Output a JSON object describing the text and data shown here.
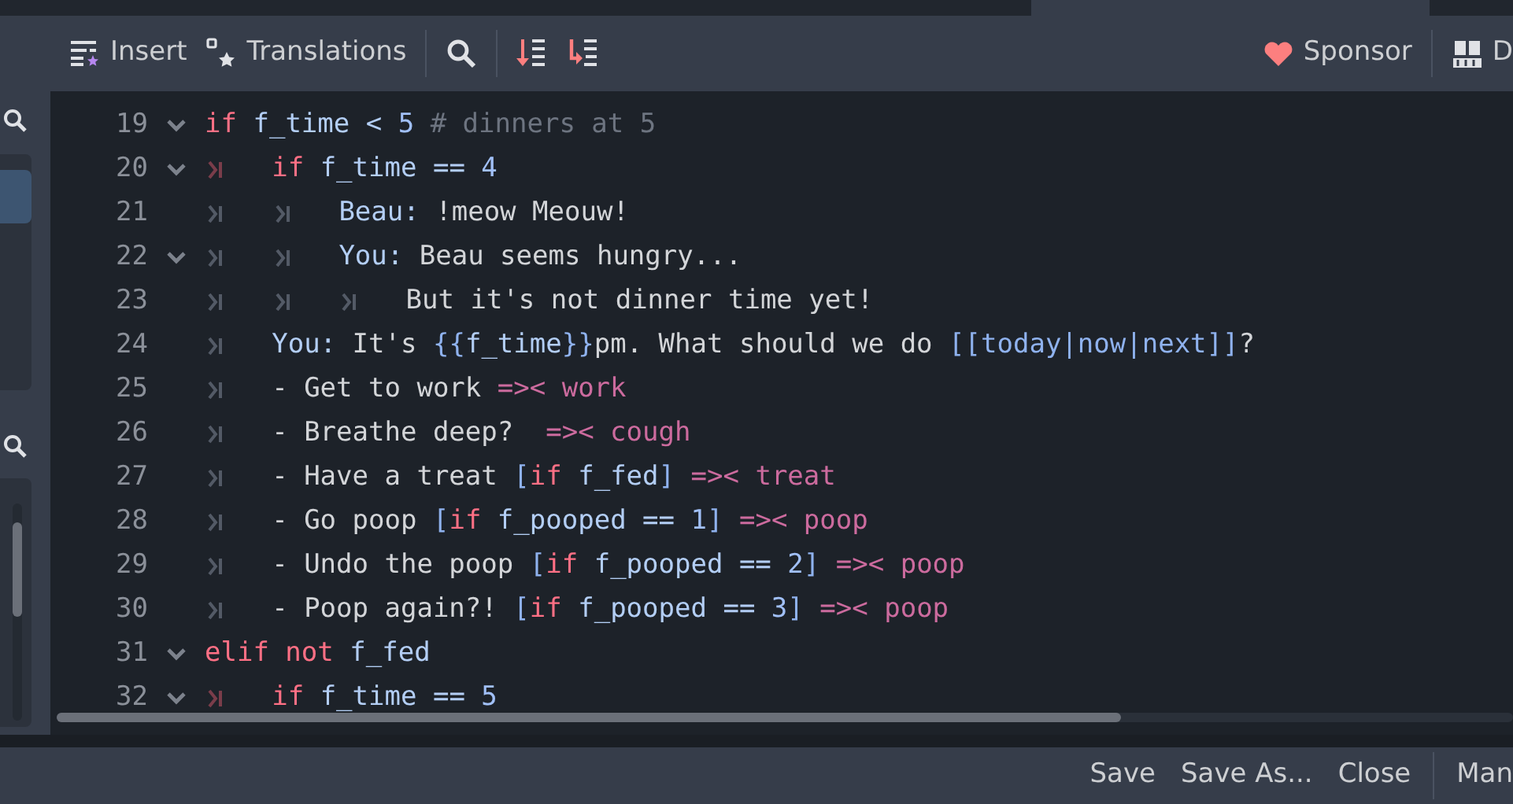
{
  "toolbar": {
    "left": [
      {
        "kind": "insert",
        "label": "Insert"
      },
      {
        "kind": "translations",
        "label": "Translations"
      },
      {
        "kind": "search"
      },
      {
        "kind": "go-down"
      },
      {
        "kind": "go-next"
      }
    ],
    "right": [
      {
        "kind": "sponsor",
        "label": "Sponsor"
      },
      {
        "kind": "docs",
        "label": "D"
      }
    ]
  },
  "editor": {
    "lines": [
      {
        "number": "19",
        "foldable": true,
        "tokens": [
          {
            "kind": "kw",
            "text": "if"
          },
          {
            "kind": "var",
            "text": " f_time < "
          },
          {
            "kind": "num",
            "text": "5"
          },
          {
            "kind": "comment",
            "text": " # dinners at 5"
          }
        ]
      },
      {
        "number": "20",
        "foldable": true,
        "tabs": [
          {
            "accent": true
          }
        ],
        "tokens": [
          {
            "kind": "kw",
            "text": "if"
          },
          {
            "kind": "var",
            "text": " f_time == "
          },
          {
            "kind": "num",
            "text": "4"
          }
        ]
      },
      {
        "number": "21",
        "foldable": false,
        "tabs": [
          {
            "accent": false
          },
          {
            "accent": false
          }
        ],
        "tokens": [
          {
            "kind": "var",
            "text": "Beau:"
          },
          {
            "kind": "text",
            "text": " !meow Meouw!"
          }
        ]
      },
      {
        "number": "22",
        "foldable": true,
        "tabs": [
          {
            "accent": false
          },
          {
            "accent": false
          }
        ],
        "tokens": [
          {
            "kind": "var",
            "text": "You:"
          },
          {
            "kind": "text",
            "text": " Beau seems hungry..."
          }
        ]
      },
      {
        "number": "23",
        "foldable": false,
        "tabs": [
          {
            "accent": false
          },
          {
            "accent": false
          },
          {
            "accent": false
          }
        ],
        "tokens": [
          {
            "kind": "text",
            "text": "But it's not dinner time yet!"
          }
        ]
      },
      {
        "number": "24",
        "foldable": false,
        "tabs": [
          {
            "accent": false
          }
        ],
        "tokens": [
          {
            "kind": "var",
            "text": "You:"
          },
          {
            "kind": "text",
            "text": " It's "
          },
          {
            "kind": "bracket",
            "text": "{{"
          },
          {
            "kind": "var",
            "text": "f_time"
          },
          {
            "kind": "bracket",
            "text": "}}"
          },
          {
            "kind": "text",
            "text": "pm. What should we do "
          },
          {
            "kind": "bracket",
            "text": "[[today|now|next]]"
          },
          {
            "kind": "text",
            "text": "?"
          }
        ]
      },
      {
        "number": "25",
        "foldable": false,
        "tabs": [
          {
            "accent": false
          }
        ],
        "tokens": [
          {
            "kind": "text",
            "text": "- Get to work "
          },
          {
            "kind": "jump",
            "text": "=>< work"
          }
        ]
      },
      {
        "number": "26",
        "foldable": false,
        "tabs": [
          {
            "accent": false
          }
        ],
        "tokens": [
          {
            "kind": "text",
            "text": "- Breathe deep?  "
          },
          {
            "kind": "jump",
            "text": "=>< cough"
          }
        ]
      },
      {
        "number": "27",
        "foldable": false,
        "tabs": [
          {
            "accent": false
          }
        ],
        "tokens": [
          {
            "kind": "text",
            "text": "- Have a treat "
          },
          {
            "kind": "bracket",
            "text": "["
          },
          {
            "kind": "kw",
            "text": "if"
          },
          {
            "kind": "var",
            "text": " f_fed"
          },
          {
            "kind": "bracket",
            "text": "] "
          },
          {
            "kind": "jump",
            "text": "=>< treat"
          }
        ]
      },
      {
        "number": "28",
        "foldable": false,
        "tabs": [
          {
            "accent": false
          }
        ],
        "tokens": [
          {
            "kind": "text",
            "text": "- Go poop "
          },
          {
            "kind": "bracket",
            "text": "["
          },
          {
            "kind": "kw",
            "text": "if"
          },
          {
            "kind": "var",
            "text": " f_pooped == "
          },
          {
            "kind": "num",
            "text": "1"
          },
          {
            "kind": "bracket",
            "text": "] "
          },
          {
            "kind": "jump",
            "text": "=>< poop"
          }
        ]
      },
      {
        "number": "29",
        "foldable": false,
        "tabs": [
          {
            "accent": false
          }
        ],
        "tokens": [
          {
            "kind": "text",
            "text": "- Undo the poop "
          },
          {
            "kind": "bracket",
            "text": "["
          },
          {
            "kind": "kw",
            "text": "if"
          },
          {
            "kind": "var",
            "text": " f_pooped == "
          },
          {
            "kind": "num",
            "text": "2"
          },
          {
            "kind": "bracket",
            "text": "] "
          },
          {
            "kind": "jump",
            "text": "=>< poop"
          }
        ]
      },
      {
        "number": "30",
        "foldable": false,
        "tabs": [
          {
            "accent": false
          }
        ],
        "tokens": [
          {
            "kind": "text",
            "text": "- Poop again?! "
          },
          {
            "kind": "bracket",
            "text": "["
          },
          {
            "kind": "kw",
            "text": "if"
          },
          {
            "kind": "var",
            "text": " f_pooped == "
          },
          {
            "kind": "num",
            "text": "3"
          },
          {
            "kind": "bracket",
            "text": "] "
          },
          {
            "kind": "jump",
            "text": "=>< poop"
          }
        ]
      },
      {
        "number": "31",
        "foldable": true,
        "tokens": [
          {
            "kind": "kw",
            "text": "elif not"
          },
          {
            "kind": "var",
            "text": " f_fed"
          }
        ]
      },
      {
        "number": "32",
        "foldable": true,
        "tabs": [
          {
            "accent": true
          }
        ],
        "tokens": [
          {
            "kind": "kw",
            "text": "if"
          },
          {
            "kind": "var",
            "text": " f_time == "
          },
          {
            "kind": "num",
            "text": "5"
          }
        ]
      }
    ]
  },
  "bottom_bar": {
    "buttons": [
      "Save",
      "Save As...",
      "Close"
    ],
    "extra": "Man"
  }
}
